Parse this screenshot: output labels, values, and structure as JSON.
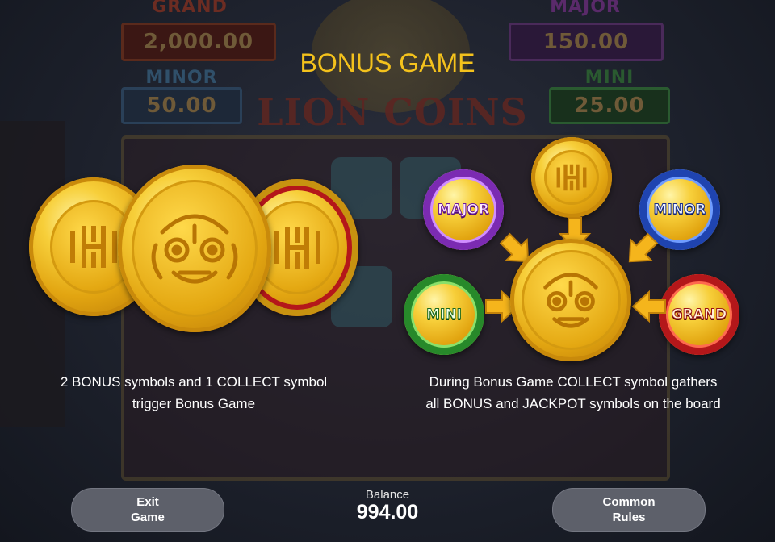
{
  "background": {
    "jackpots": {
      "grand": {
        "label": "GRAND",
        "value": "2,000.00"
      },
      "major": {
        "label": "MAJOR",
        "value": "150.00"
      },
      "minor": {
        "label": "MINOR",
        "value": "50.00"
      },
      "mini": {
        "label": "MINI",
        "value": "25.00"
      }
    },
    "logo": "LION COINS"
  },
  "title": "BONUS GAME",
  "left_panel": {
    "caption_line1": "2 BONUS symbols and 1 COLLECT symbol",
    "caption_line2": "trigger Bonus Game",
    "coins": [
      "bonus-coin-icon",
      "collect-coin-icon",
      "bonus-coin-icon"
    ]
  },
  "right_panel": {
    "caption_line1": "During Bonus Game COLLECT symbol gathers",
    "caption_line2": "all BONUS and JACKPOT symbols on the board",
    "coins": {
      "major": "MAJOR",
      "minor": "MINOR",
      "mini": "MINI",
      "grand": "GRAND"
    }
  },
  "footer": {
    "exit_label_line1": "Exit",
    "exit_label_line2": "Game",
    "balance_label": "Balance",
    "balance_value": "994.00",
    "rules_label_line1": "Common",
    "rules_label_line2": "Rules"
  },
  "colors": {
    "title": "#f4c21c",
    "major_ring": "#7b2bb2",
    "minor_ring": "#1f44b0",
    "mini_ring": "#27892a",
    "grand_ring": "#b4171a",
    "button_bg": "#5d606a"
  }
}
